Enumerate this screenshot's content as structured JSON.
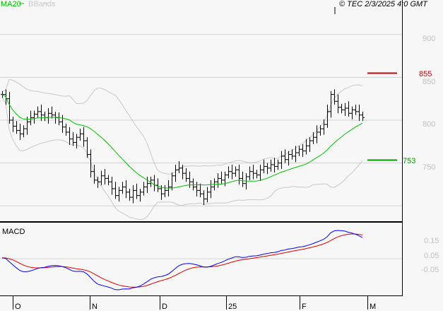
{
  "legend": {
    "ma20": "MA20",
    "bbands": "BBands",
    "copyright": "© TEC 2/3/2025 4:0 GMT"
  },
  "colors": {
    "ma": "#00c000",
    "bb": "#c8c8c8",
    "macd": "#0000ff",
    "signal": "#e00000",
    "resistance": "#cc0000",
    "support": "#009900"
  },
  "chart_data": {
    "type": "bar",
    "title": "Price (OHLC bars) with MA20, Bollinger Bands and MACD",
    "price_ticks": [
      "900",
      "850",
      "800",
      "750"
    ],
    "price_ylim": [
      690,
      925
    ],
    "macd_panel_label": "MACD",
    "macd_ticks": [
      "0.15",
      "0.05",
      "-0.05"
    ],
    "x_labels": [
      "O",
      "N",
      "D",
      "25",
      "F",
      "M"
    ],
    "resistance": {
      "value": 855,
      "label": "855"
    },
    "support": {
      "value": 753,
      "label": "753"
    },
    "closes": [
      830,
      825,
      800,
      793,
      788,
      784,
      790,
      798,
      803,
      807,
      810,
      806,
      803,
      808,
      806,
      803,
      798,
      792,
      786,
      778,
      774,
      780,
      784,
      776,
      760,
      740,
      730,
      728,
      735,
      732,
      728,
      720,
      712,
      718,
      722,
      716,
      710,
      718,
      712,
      716,
      722,
      726,
      730,
      724,
      720,
      714,
      718,
      722,
      735,
      742,
      744,
      738,
      732,
      728,
      722,
      718,
      714,
      708,
      716,
      722,
      728,
      732,
      730,
      736,
      740,
      738,
      742,
      732,
      726,
      734,
      740,
      738,
      736,
      742,
      746,
      744,
      748,
      746,
      750,
      758,
      754,
      760,
      758,
      762,
      766,
      764,
      770,
      776,
      780,
      786,
      790,
      795,
      810,
      830,
      822,
      815,
      812,
      814,
      808,
      812,
      810,
      806,
      803
    ]
  }
}
